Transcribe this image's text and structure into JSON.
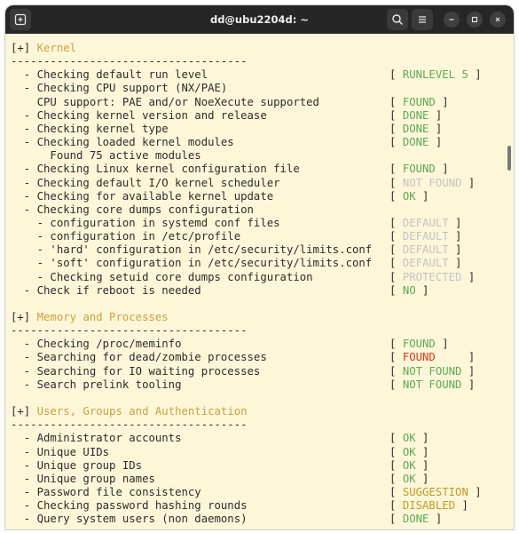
{
  "window": {
    "title": "dd@ubu2204d: ~"
  },
  "icons": {
    "new_tab": "new-tab-icon",
    "search": "search-icon",
    "menu": "hamburger-menu-icon",
    "minimize": "minimize-icon",
    "maximize": "maximize-icon",
    "close": "close-icon"
  },
  "colors": {
    "section": "#c7a240",
    "ok": "#5daa55",
    "muted": "#c3c3c3",
    "error": "#d43a1e",
    "warning": "#c09a2a"
  },
  "lines": [
    {
      "type": "section",
      "text": "Kernel"
    },
    {
      "type": "rule",
      "text": "------------------------------------"
    },
    {
      "type": "check",
      "text": "  - Checking default run level",
      "status": "RUNLEVEL 5",
      "st": "green"
    },
    {
      "type": "check",
      "text": "  - Checking CPU support (NX/PAE)"
    },
    {
      "type": "check",
      "text": "    CPU support: PAE and/or NoeXecute supported",
      "status": "FOUND",
      "st": "green"
    },
    {
      "type": "check",
      "text": "  - Checking kernel version and release",
      "status": "DONE",
      "st": "green"
    },
    {
      "type": "check",
      "text": "  - Checking kernel type",
      "status": "DONE",
      "st": "green"
    },
    {
      "type": "check",
      "text": "  - Checking loaded kernel modules",
      "status": "DONE",
      "st": "green"
    },
    {
      "type": "check",
      "text": "      Found 75 active modules"
    },
    {
      "type": "check",
      "text": "  - Checking Linux kernel configuration file",
      "status": "FOUND",
      "st": "green"
    },
    {
      "type": "check",
      "text": "  - Checking default I/O kernel scheduler",
      "status": "NOT FOUND",
      "st": "gray"
    },
    {
      "type": "check",
      "text": "  - Checking for available kernel update",
      "status": "OK",
      "st": "green"
    },
    {
      "type": "check",
      "text": "  - Checking core dumps configuration"
    },
    {
      "type": "check",
      "text": "    - configuration in systemd conf files",
      "status": "DEFAULT",
      "st": "gray"
    },
    {
      "type": "check",
      "text": "    - configuration in /etc/profile",
      "status": "DEFAULT",
      "st": "gray"
    },
    {
      "type": "check",
      "text": "    - 'hard' configuration in /etc/security/limits.conf",
      "status": "DEFAULT",
      "st": "gray"
    },
    {
      "type": "check",
      "text": "    - 'soft' configuration in /etc/security/limits.conf",
      "status": "DEFAULT",
      "st": "gray"
    },
    {
      "type": "check",
      "text": "    - Checking setuid core dumps configuration",
      "status": "PROTECTED",
      "st": "gray"
    },
    {
      "type": "check",
      "text": "  - Check if reboot is needed",
      "status": "NO",
      "st": "green"
    },
    {
      "type": "blank",
      "text": ""
    },
    {
      "type": "section",
      "text": "Memory and Processes"
    },
    {
      "type": "rule",
      "text": "------------------------------------"
    },
    {
      "type": "check",
      "text": "  - Checking /proc/meminfo",
      "status": "FOUND",
      "st": "green"
    },
    {
      "type": "check",
      "text": "  - Searching for dead/zombie processes",
      "status": "FOUND",
      "st": "red",
      "pad": "    "
    },
    {
      "type": "check",
      "text": "  - Searching for IO waiting processes",
      "status": "NOT FOUND",
      "st": "green"
    },
    {
      "type": "check",
      "text": "  - Search prelink tooling",
      "status": "NOT FOUND",
      "st": "green"
    },
    {
      "type": "blank",
      "text": ""
    },
    {
      "type": "section",
      "text": "Users, Groups and Authentication"
    },
    {
      "type": "rule",
      "text": "------------------------------------"
    },
    {
      "type": "check",
      "text": "  - Administrator accounts",
      "status": "OK",
      "st": "green"
    },
    {
      "type": "check",
      "text": "  - Unique UIDs",
      "status": "OK",
      "st": "green"
    },
    {
      "type": "check",
      "text": "  - Unique group IDs",
      "status": "OK",
      "st": "green"
    },
    {
      "type": "check",
      "text": "  - Unique group names",
      "status": "OK",
      "st": "green"
    },
    {
      "type": "check",
      "text": "  - Password file consistency",
      "status": "SUGGESTION",
      "st": "yellow"
    },
    {
      "type": "check",
      "text": "  - Checking password hashing rounds",
      "status": "DISABLED",
      "st": "yellow"
    },
    {
      "type": "check",
      "text": "  - Query system users (non daemons)",
      "status": "DONE",
      "st": "green"
    }
  ]
}
